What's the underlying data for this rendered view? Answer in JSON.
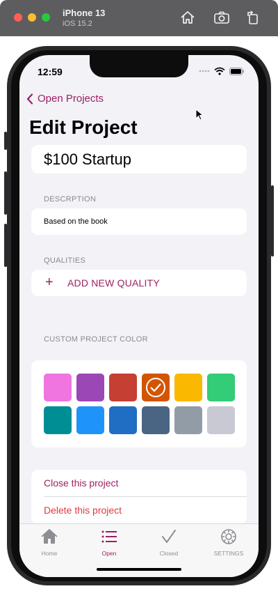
{
  "simulator": {
    "device_name": "iPhone 13",
    "os_version": "iOS 15.2",
    "toolbar_icons": [
      "home-icon",
      "screenshot-icon",
      "rotate-icon"
    ]
  },
  "status_bar": {
    "time": "12:59"
  },
  "navigation": {
    "back_label": "Open Projects",
    "title": "Edit Project"
  },
  "project": {
    "name": "$100 Startup",
    "description_label": "DESCRPTION",
    "description": "Based on the book"
  },
  "qualities": {
    "section_label": "QUALITIES",
    "add_label": "ADD NEW QUALITY"
  },
  "colors": {
    "section_label": "CUSTOM PROJECT COLOR",
    "swatches": [
      "#f075e0",
      "#9b47b5",
      "#c63f33",
      "#d35500",
      "#fbb800",
      "#33cc77",
      "#008e95",
      "#1e94fb",
      "#1f6ec3",
      "#4a6584",
      "#919ca6",
      "#c8c9d2"
    ],
    "selected_index": 3
  },
  "actions": {
    "close_label": "Close this project",
    "delete_label": "Delete this project"
  },
  "tabs": [
    {
      "label": "Home",
      "icon": "house-icon",
      "active": false
    },
    {
      "label": "Open",
      "icon": "list-icon",
      "active": true
    },
    {
      "label": "Closed",
      "icon": "checkmark-icon",
      "active": false
    },
    {
      "label": "SETTINGS",
      "icon": "gear-icon",
      "active": false
    }
  ],
  "theme": {
    "accent": "#9d1f62",
    "destructive": "#e0393e",
    "inactive": "#8e8e93"
  }
}
